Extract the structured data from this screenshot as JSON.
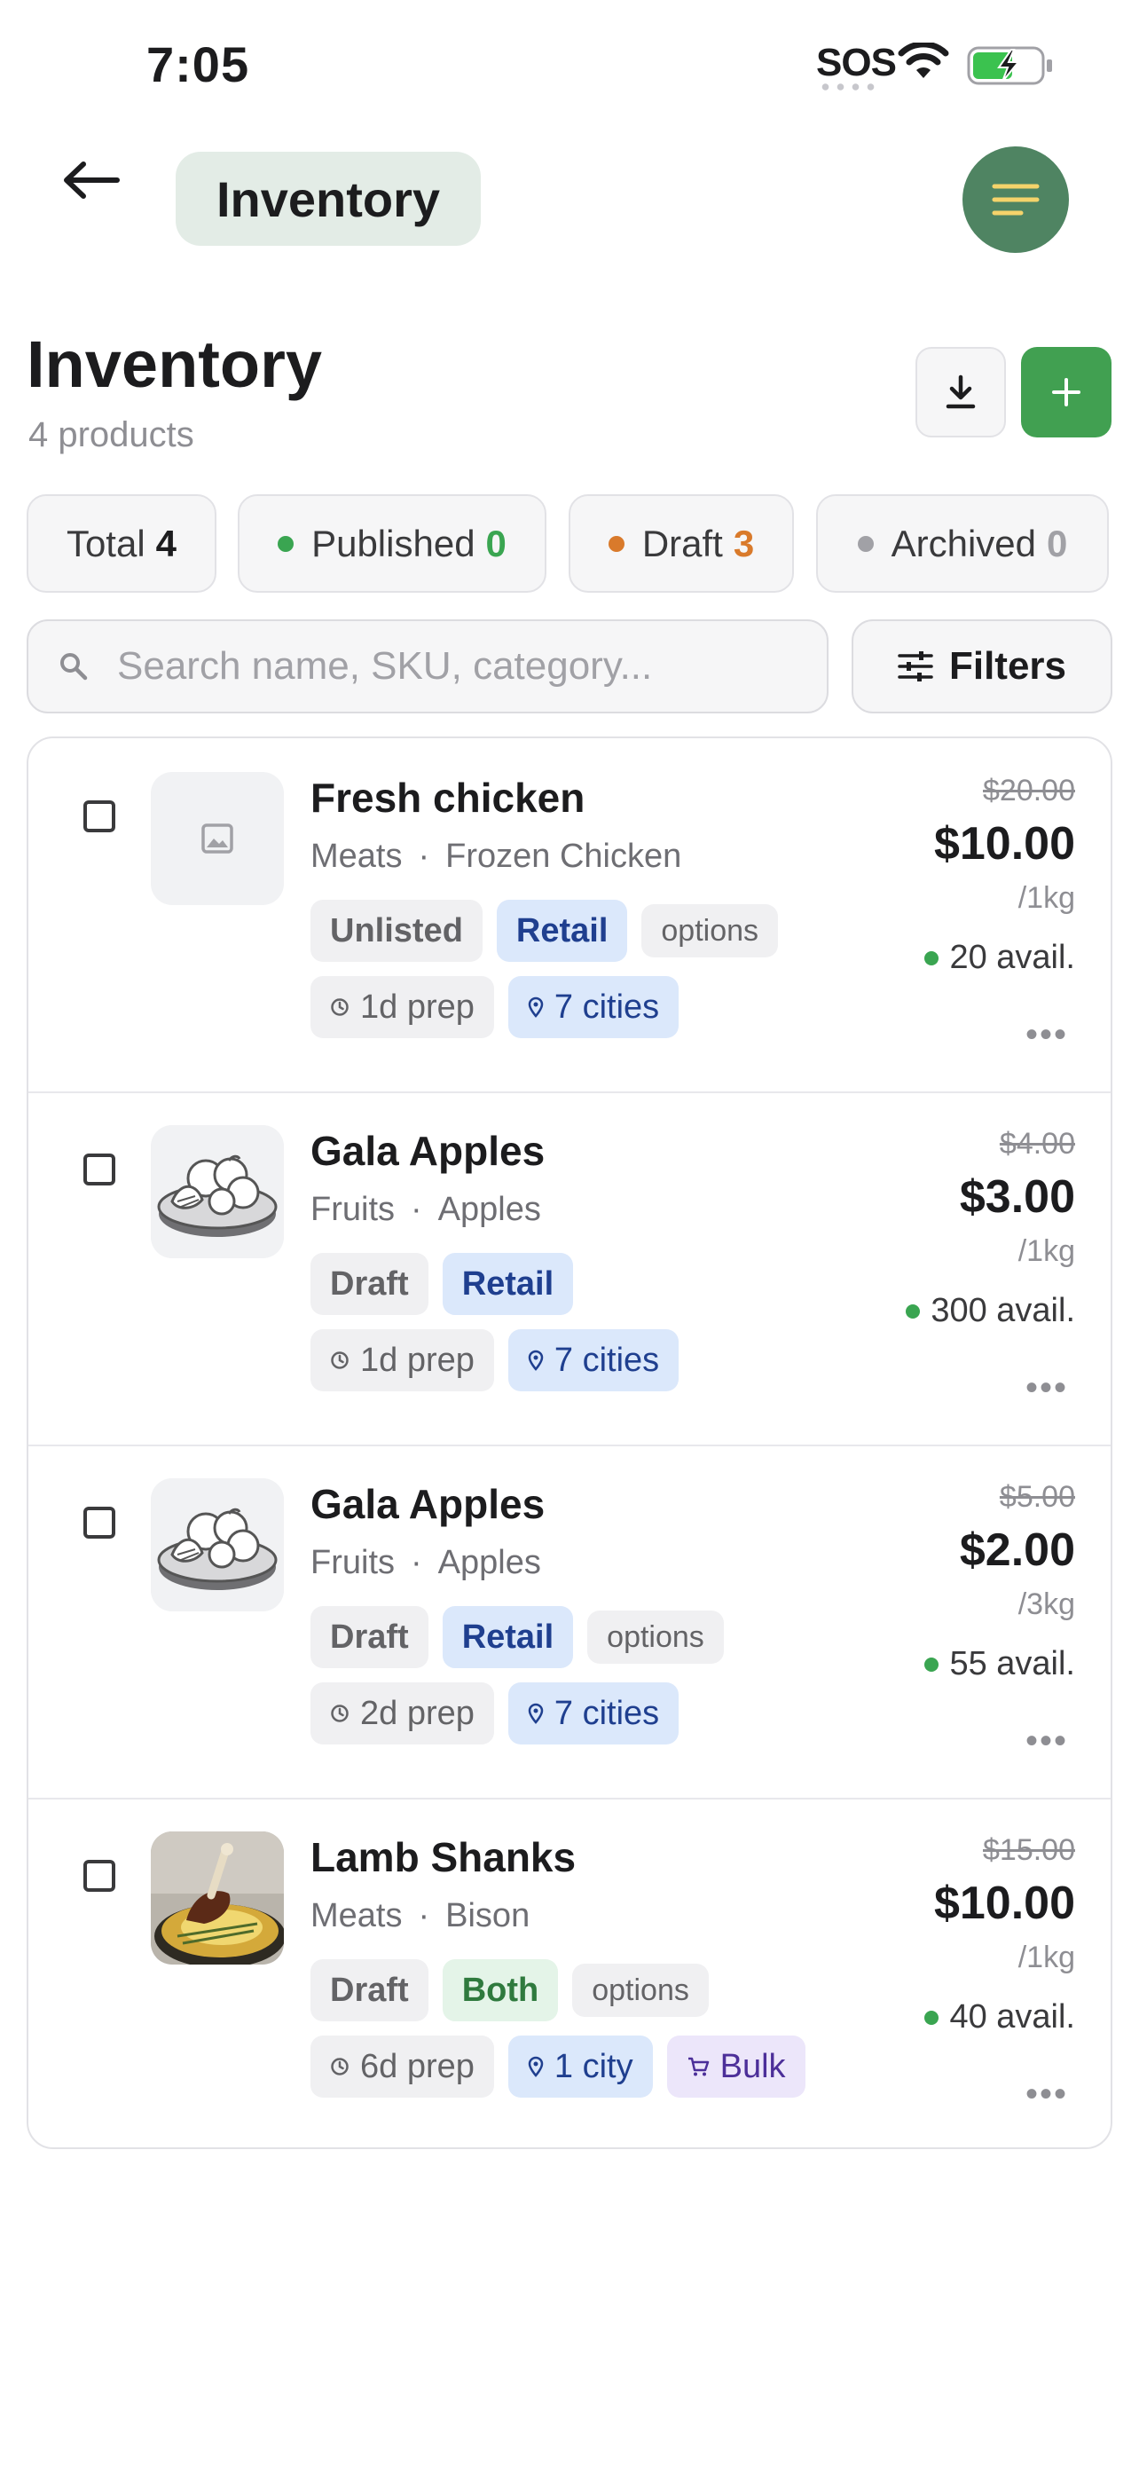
{
  "status_bar": {
    "time": "7:05",
    "sos": "SOS"
  },
  "nav": {
    "title": "Inventory"
  },
  "header": {
    "title": "Inventory",
    "subtitle": "4 products"
  },
  "stats": [
    {
      "label": "Total",
      "count": "4",
      "color": "#1c1c1e"
    },
    {
      "label": "Published",
      "count": "0",
      "color": "#3aa551"
    },
    {
      "label": "Draft",
      "count": "3",
      "color": "#d97a2b"
    },
    {
      "label": "Archived",
      "count": "0",
      "color": "#a1a1a6"
    }
  ],
  "search": {
    "placeholder": "Search name, SKU, category...",
    "value": ""
  },
  "filters": {
    "label": "Filters"
  },
  "products": [
    {
      "name": "Fresh chicken",
      "category": "Meats",
      "subcategory": "Frozen Chicken",
      "status": "Unlisted",
      "channel": "Retail",
      "options": "options",
      "prep": "1d prep",
      "cities": "7 cities",
      "bulk": null,
      "old_price": "$20.00",
      "price": "$10.00",
      "unit": "/1kg",
      "avail": "20 avail.",
      "image": "placeholder-image-icon"
    },
    {
      "name": "Gala Apples",
      "category": "Fruits",
      "subcategory": "Apples",
      "status": "Draft",
      "channel": "Retail",
      "options": null,
      "prep": "1d prep",
      "cities": "7 cities",
      "bulk": null,
      "old_price": "$4.00",
      "price": "$3.00",
      "unit": "/1kg",
      "avail": "300 avail.",
      "image": "produce-bowl-icon"
    },
    {
      "name": "Gala Apples",
      "category": "Fruits",
      "subcategory": "Apples",
      "status": "Draft",
      "channel": "Retail",
      "options": "options",
      "prep": "2d prep",
      "cities": "7 cities",
      "bulk": null,
      "old_price": "$5.00",
      "price": "$2.00",
      "unit": "/3kg",
      "avail": "55 avail.",
      "image": "produce-bowl-icon"
    },
    {
      "name": "Lamb Shanks",
      "category": "Meats",
      "subcategory": "Bison",
      "status": "Draft",
      "channel": "Both",
      "options": "options",
      "prep": "6d prep",
      "cities": "1 city",
      "bulk": "Bulk",
      "old_price": "$15.00",
      "price": "$10.00",
      "unit": "/1kg",
      "avail": "40 avail.",
      "image": "lamb-shank-photo"
    }
  ],
  "more_label": "•••"
}
